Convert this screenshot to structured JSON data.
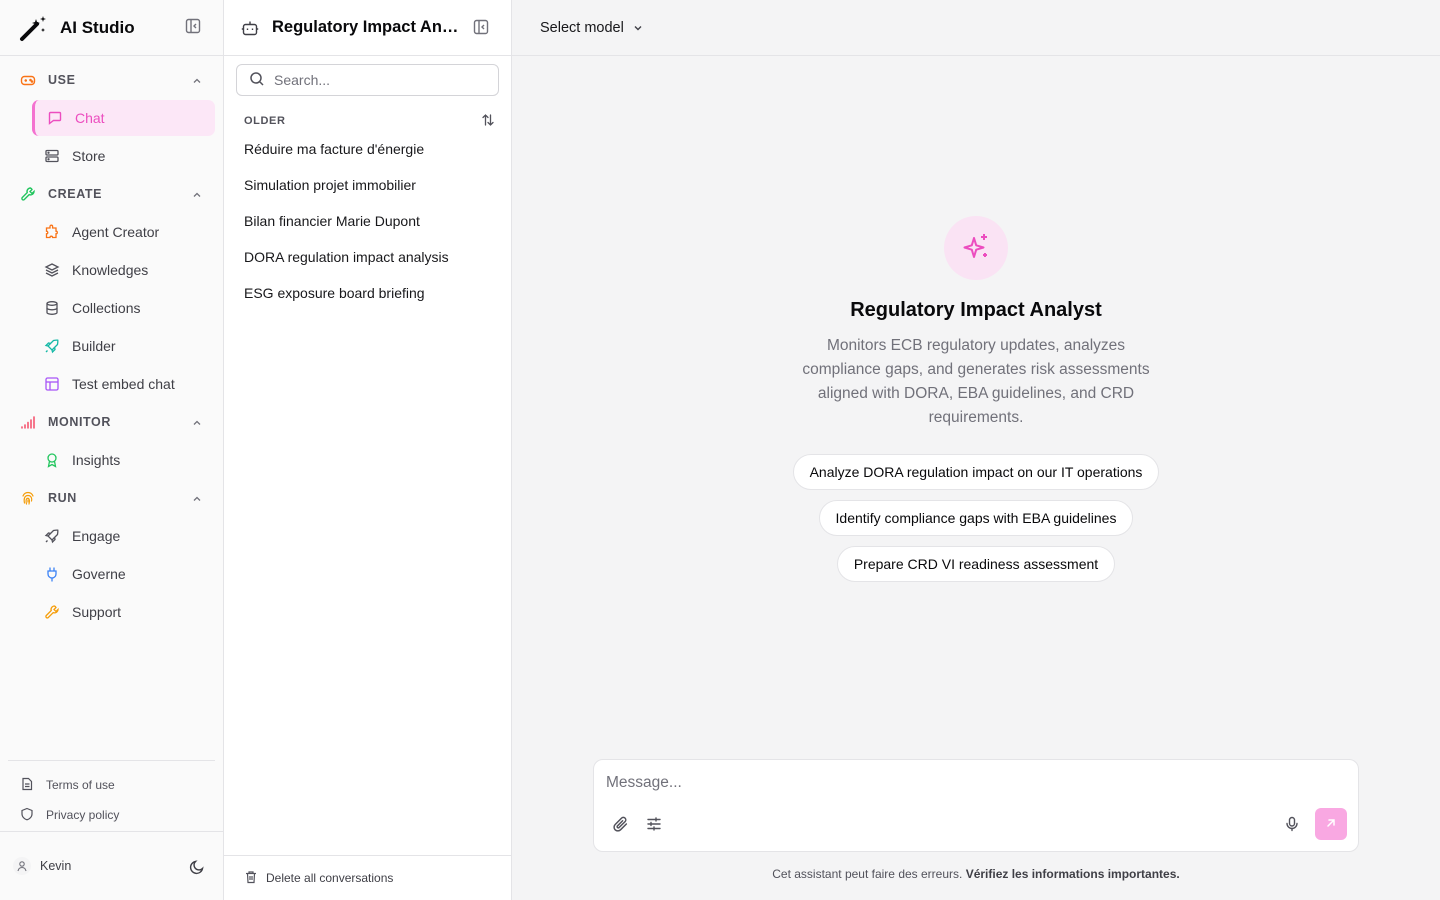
{
  "app": {
    "title": "AI Studio"
  },
  "sidebar": {
    "sections": [
      {
        "label": "USE",
        "items": [
          {
            "label": "Chat",
            "active": true
          },
          {
            "label": "Store"
          }
        ]
      },
      {
        "label": "CREATE",
        "items": [
          {
            "label": "Agent Creator"
          },
          {
            "label": "Knowledges"
          },
          {
            "label": "Collections"
          },
          {
            "label": "Builder"
          },
          {
            "label": "Test embed chat"
          }
        ]
      },
      {
        "label": "MONITOR",
        "items": [
          {
            "label": "Insights"
          }
        ]
      },
      {
        "label": "RUN",
        "items": [
          {
            "label": "Engage"
          },
          {
            "label": "Governe"
          },
          {
            "label": "Support"
          }
        ]
      }
    ],
    "footer": {
      "terms": "Terms of use",
      "privacy": "Privacy policy"
    },
    "user": {
      "name": "Kevin"
    }
  },
  "conversations": {
    "agent_title": "Regulatory Impact Anal...",
    "search_placeholder": "Search...",
    "group_label": "OLDER",
    "items": [
      "Réduire ma facture d'énergie",
      "Simulation projet immobilier",
      "Bilan financier Marie Dupont",
      "DORA regulation impact analysis",
      "ESG exposure board briefing"
    ],
    "delete_all": "Delete all conversations"
  },
  "main": {
    "model_select": "Select model",
    "agent_name": "Regulatory Impact Analyst",
    "agent_description": "Monitors ECB regulatory updates, analyzes compliance gaps, and generates risk assessments aligned with DORA, EBA guidelines, and CRD requirements.",
    "suggestions": [
      "Analyze DORA regulation impact on our IT operations",
      "Identify compliance gaps with EBA guidelines",
      "Prepare CRD VI readiness assessment"
    ],
    "composer_placeholder": "Message...",
    "disclaimer": "Cet assistant peut faire des erreurs.",
    "disclaimer_bold": "Vérifiez les informations importantes."
  },
  "colors": {
    "accent": "#ec4dbf",
    "accent_bg": "#fce7f7",
    "send_button": "#f9a8e2",
    "border": "#e4e4e7"
  }
}
